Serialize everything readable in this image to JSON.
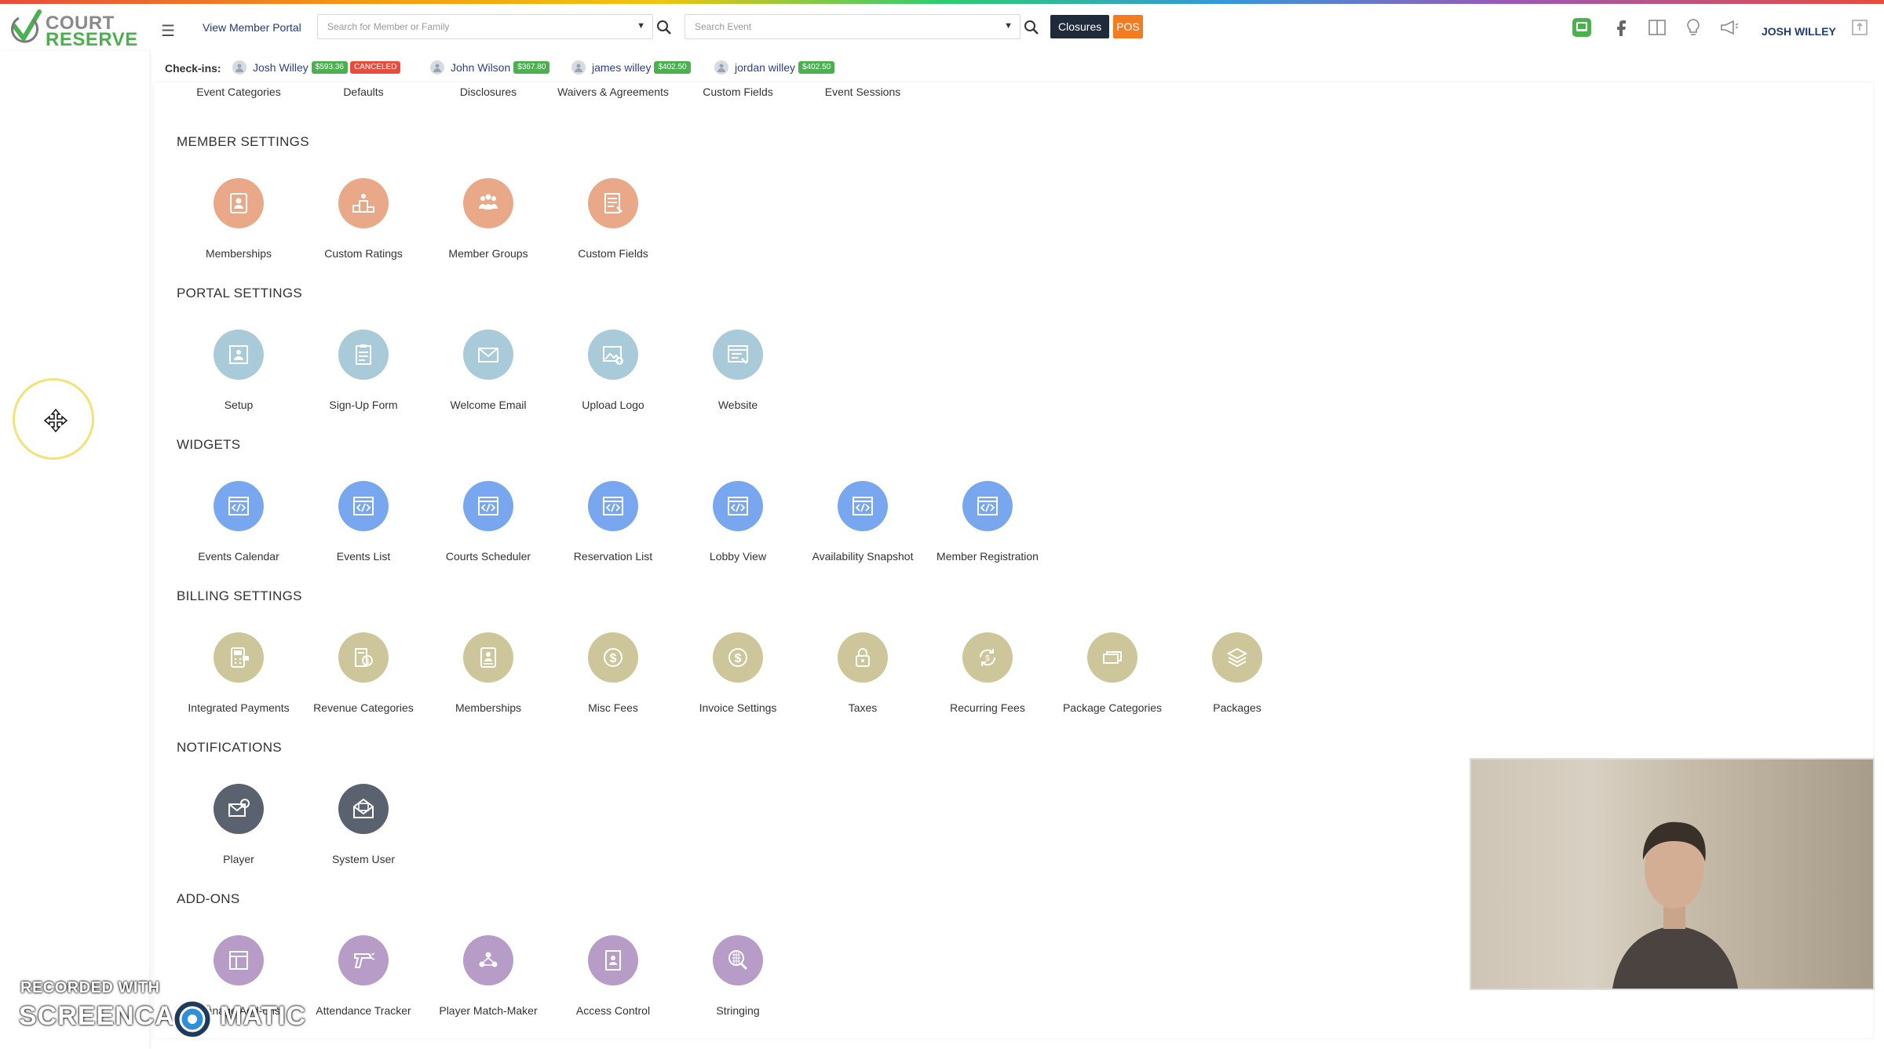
{
  "header": {
    "logo_line1": "COURT",
    "logo_line2": "RESERVE",
    "view_member_portal": "View Member Portal",
    "member_search_placeholder": "Search for Member or Family",
    "event_search_placeholder": "Search Event",
    "closures_label": "Closures",
    "pos_label": "POS",
    "user_name": "JOSH WILLEY"
  },
  "checkins": {
    "label": "Check-ins:",
    "items": [
      {
        "name": "Josh Willey",
        "amount": "$593.36",
        "status": "CANCELED"
      },
      {
        "name": "John Wilson",
        "amount": "$367.80"
      },
      {
        "name": "james willey",
        "amount": "$402.50"
      },
      {
        "name": "jordan willey",
        "amount": "$402.50"
      }
    ]
  },
  "event_settings_row": [
    "Event Categories",
    "Defaults",
    "Disclosures",
    "Waivers & Agreements",
    "Custom Fields",
    "Event Sessions"
  ],
  "sections": {
    "member": {
      "title": "MEMBER SETTINGS",
      "items": [
        "Memberships",
        "Custom Ratings",
        "Member Groups",
        "Custom Fields"
      ]
    },
    "portal": {
      "title": "PORTAL SETTINGS",
      "items": [
        "Setup",
        "Sign-Up Form",
        "Welcome Email",
        "Upload Logo",
        "Website"
      ]
    },
    "widgets": {
      "title": "WIDGETS",
      "items": [
        "Events Calendar",
        "Events List",
        "Courts Scheduler",
        "Reservation List",
        "Lobby View",
        "Availability Snapshot",
        "Member Registration"
      ]
    },
    "billing": {
      "title": "BILLING SETTINGS",
      "items": [
        "Integrated Payments",
        "Revenue Categories",
        "Memberships",
        "Misc Fees",
        "Invoice Settings",
        "Taxes",
        "Recurring Fees",
        "Package Categories",
        "Packages"
      ]
    },
    "notifications": {
      "title": "NOTIFICATIONS",
      "items": [
        "Player",
        "System User"
      ]
    },
    "addons": {
      "title": "ADD-ONS",
      "items": [
        "Manage Add-ons",
        "Attendance Tracker",
        "Player Match-Maker",
        "Access Control",
        "Stringing"
      ]
    }
  },
  "watermark": {
    "line1": "RECORDED WITH",
    "line2a": "SCREENCAST",
    "line2b": "MATIC"
  },
  "colors": {
    "member": "#e9a888",
    "portal": "#a9cbd9",
    "widget": "#78a7ef",
    "billing": "#ccc69a",
    "notifications": "#5a6270",
    "addons": "#b79cc8",
    "closures": "#1f2a3a",
    "pos": "#f47c20"
  }
}
